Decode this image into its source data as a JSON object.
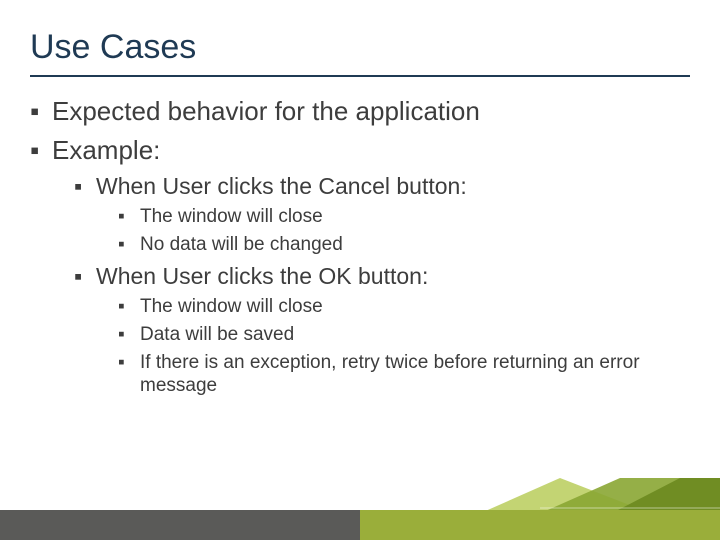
{
  "title": "Use Cases",
  "bullets_l1": {
    "b0": "Expected behavior for the application",
    "b1": "Example:"
  },
  "bullets_l2": {
    "cancel": "When User clicks the Cancel button:",
    "ok": "When User clicks the OK button:"
  },
  "cancel_items": {
    "i0": "The window will close",
    "i1": "No data will be changed"
  },
  "ok_items": {
    "i0": "The window will close",
    "i1": "Data will be saved",
    "i2": "If there is an exception, retry twice before returning an error message"
  },
  "colors": {
    "title": "#1f3a54",
    "footer_accent": "#9aae3a",
    "footer_dark": "#5a5a58"
  }
}
